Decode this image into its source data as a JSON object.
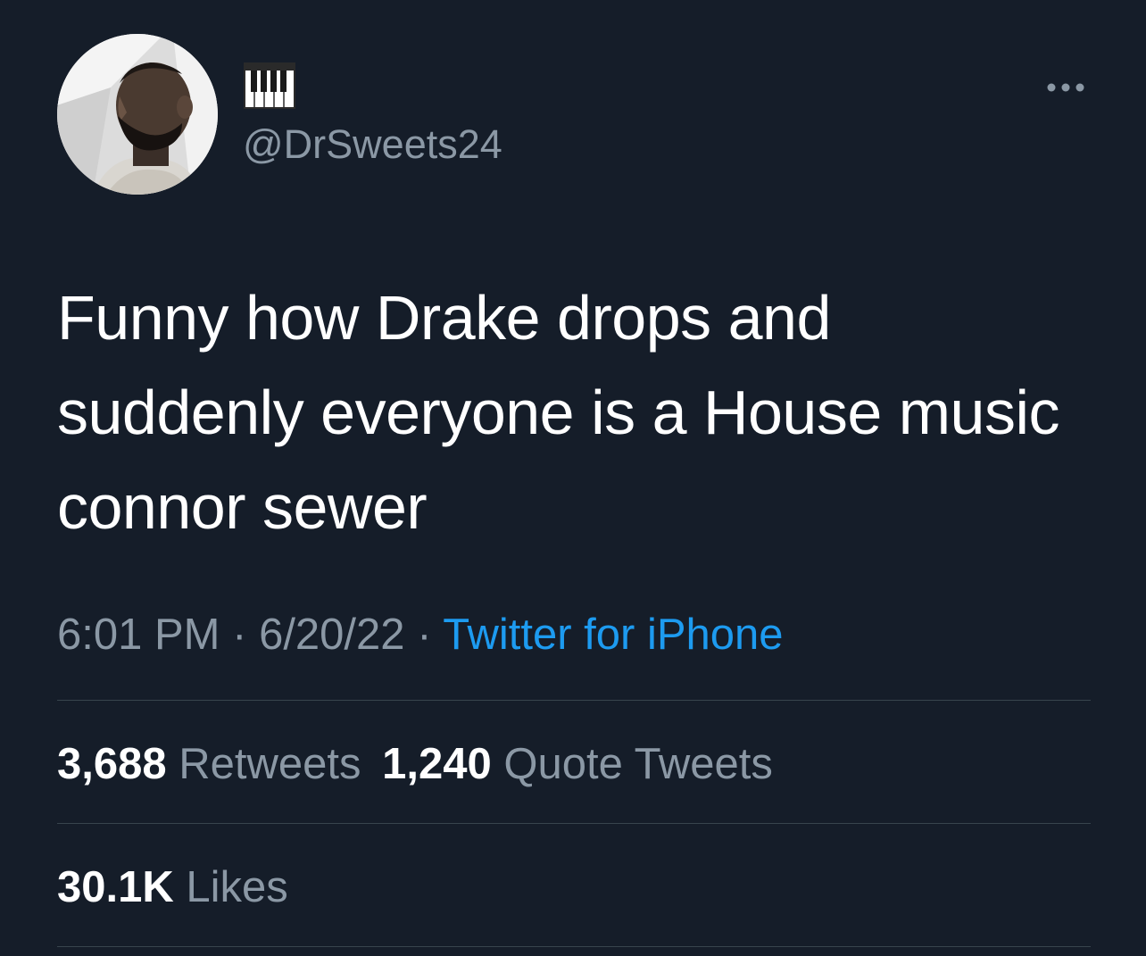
{
  "colors": {
    "background": "#151d29",
    "primary_text": "#ffffff",
    "secondary_text": "#8b98a5",
    "link": "#1d9bf0",
    "divider": "#38444d"
  },
  "author": {
    "display_name_icon": "piano-keys-icon",
    "handle": "@DrSweets24"
  },
  "menu": {
    "icon": "more-options-icon"
  },
  "tweet": {
    "lines": [
      "Funny how Drake drops and",
      "suddenly everyone is a House music",
      "connor sewer"
    ]
  },
  "meta": {
    "time": "6:01 PM",
    "separator": "·",
    "date": "6/20/22",
    "source": "Twitter for iPhone"
  },
  "stats": {
    "retweets_count": "3,688",
    "retweets_label": "Retweets",
    "quotes_count": "1,240",
    "quotes_label": "Quote Tweets",
    "likes_count": "30.1K",
    "likes_label": "Likes"
  }
}
